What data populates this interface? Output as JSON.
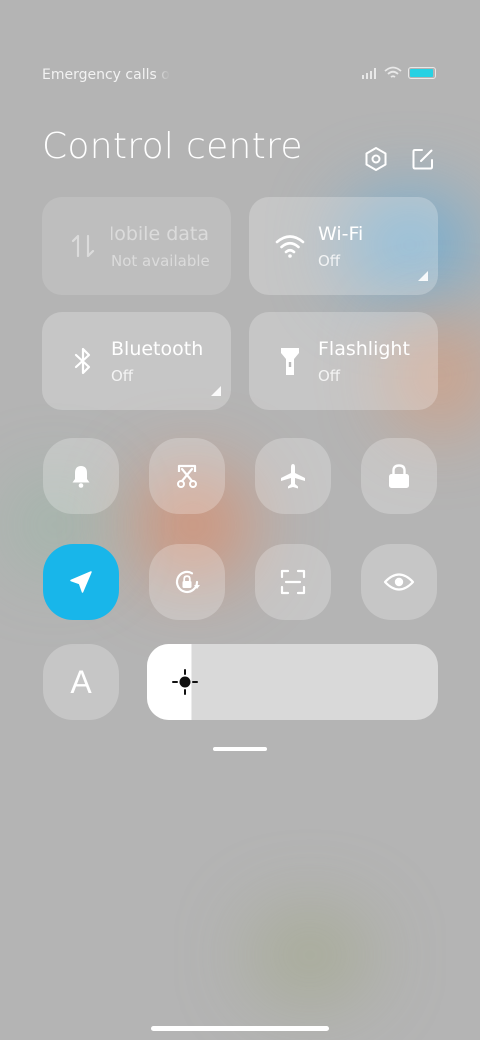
{
  "status_bar": {
    "carrier_text": "Emergency calls only",
    "battery_level": 0.95,
    "icons": [
      "signal-icon",
      "wifi-icon",
      "battery-icon"
    ]
  },
  "header": {
    "title": "Control centre",
    "settings_icon": "settings-hexagon-icon",
    "edit_icon": "edit-icon"
  },
  "tiles": {
    "mobile_data": {
      "label": "Mobile data",
      "status": "Not available",
      "icon": "mobile-data-icon"
    },
    "wifi": {
      "label": "Wi-Fi",
      "status": "Off",
      "icon": "wifi-icon"
    },
    "bluetooth": {
      "label": "Bluetooth",
      "status": "Off",
      "icon": "bluetooth-icon"
    },
    "flashlight": {
      "label": "Flashlight",
      "status": "Off",
      "icon": "flashlight-icon"
    }
  },
  "toggles": [
    {
      "name": "bell-icon",
      "active": false
    },
    {
      "name": "screenshot-icon",
      "active": false
    },
    {
      "name": "airplane-icon",
      "active": false
    },
    {
      "name": "lock-icon",
      "active": false
    },
    {
      "name": "location-icon",
      "active": true
    },
    {
      "name": "rotation-lock-icon",
      "active": false
    },
    {
      "name": "scan-icon",
      "active": false
    },
    {
      "name": "eye-icon",
      "active": false
    }
  ],
  "brightness": {
    "auto_label": "A",
    "level": 0.15,
    "icon": "brightness-icon"
  },
  "colors": {
    "accent": "#18b6ea",
    "battery": "#27d1e3"
  }
}
